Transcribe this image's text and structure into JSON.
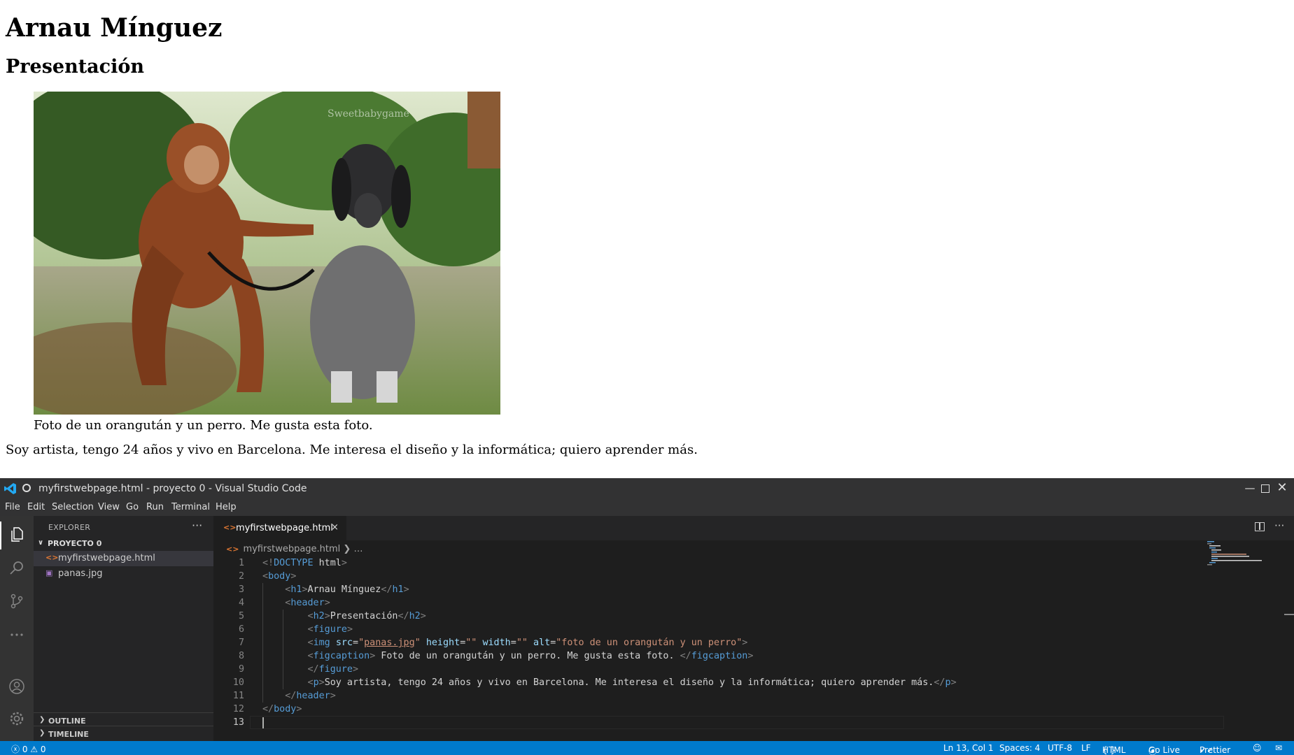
{
  "webpage": {
    "heading": "Arnau Mínguez",
    "subheading": "Presentación",
    "image_description": "foto de un orangután y un perro",
    "watermark": "Sweetbabygame",
    "caption": "Foto de un orangután y un perro. Me gusta esta foto.",
    "paragraph": "Soy artista, tengo 24 años y vivo en Barcelona. Me interesa el diseño y la informática; quiero aprender más."
  },
  "vscode": {
    "title": "myfirstwebpage.html - proyecto 0 - Visual Studio Code",
    "window_controls": [
      "minimize-icon",
      "maximize-icon",
      "close-icon"
    ],
    "menu": [
      "File",
      "Edit",
      "Selection",
      "View",
      "Go",
      "Run",
      "Terminal",
      "Help"
    ],
    "activity_bar": [
      "files-icon",
      "search-icon",
      "source-control-icon",
      "more-icon",
      "account-icon",
      "gear-icon"
    ],
    "explorer": {
      "title": "EXPLORER",
      "more": "···",
      "project": "PROYECTO 0",
      "files": [
        {
          "name": "myfirstwebpage.html",
          "icon": "html-file-icon",
          "selected": true
        },
        {
          "name": "panas.jpg",
          "icon": "image-file-icon",
          "selected": false
        }
      ],
      "panels": [
        "OUTLINE",
        "TIMELINE"
      ]
    },
    "tab": {
      "label": "myfirstwebpage.html",
      "close": "×"
    },
    "editor_actions": {
      "more": "···"
    },
    "breadcrumb": {
      "file": "myfirstwebpage.html",
      "rest": "…"
    },
    "code_lines": [
      "<!DOCTYPE html>",
      "<body>",
      "    <h1>Arnau Mínguez</h1>",
      "    <header>",
      "        <h2>Presentación</h2>",
      "        <figure>",
      "        <img src=\"panas.jpg\" height=\"\" width=\"\" alt=\"foto de un orangután y un perro\">",
      "        <figcaption> Foto de un orangután y un perro. Me gusta esta foto. </figcaption>",
      "        </figure>",
      "        <p>Soy artista, tengo 24 años y vivo en Barcelona. Me interesa el diseño y la informática; quiero aprender más.</p>",
      "    </header>",
      "</body>",
      ""
    ],
    "current_line": 13,
    "status": {
      "errors": "0",
      "warnings": "0",
      "position": "Ln 13, Col 1",
      "spaces": "Spaces: 4",
      "encoding": "UTF-8",
      "eol": "LF",
      "language": "HTML",
      "golive": "Go Live",
      "prettier": "Prettier"
    },
    "colors": {
      "statusbar": "#007acc",
      "editor_bg": "#1e1e1e",
      "sidebar_bg": "#252526",
      "activity_bg": "#333333"
    }
  }
}
